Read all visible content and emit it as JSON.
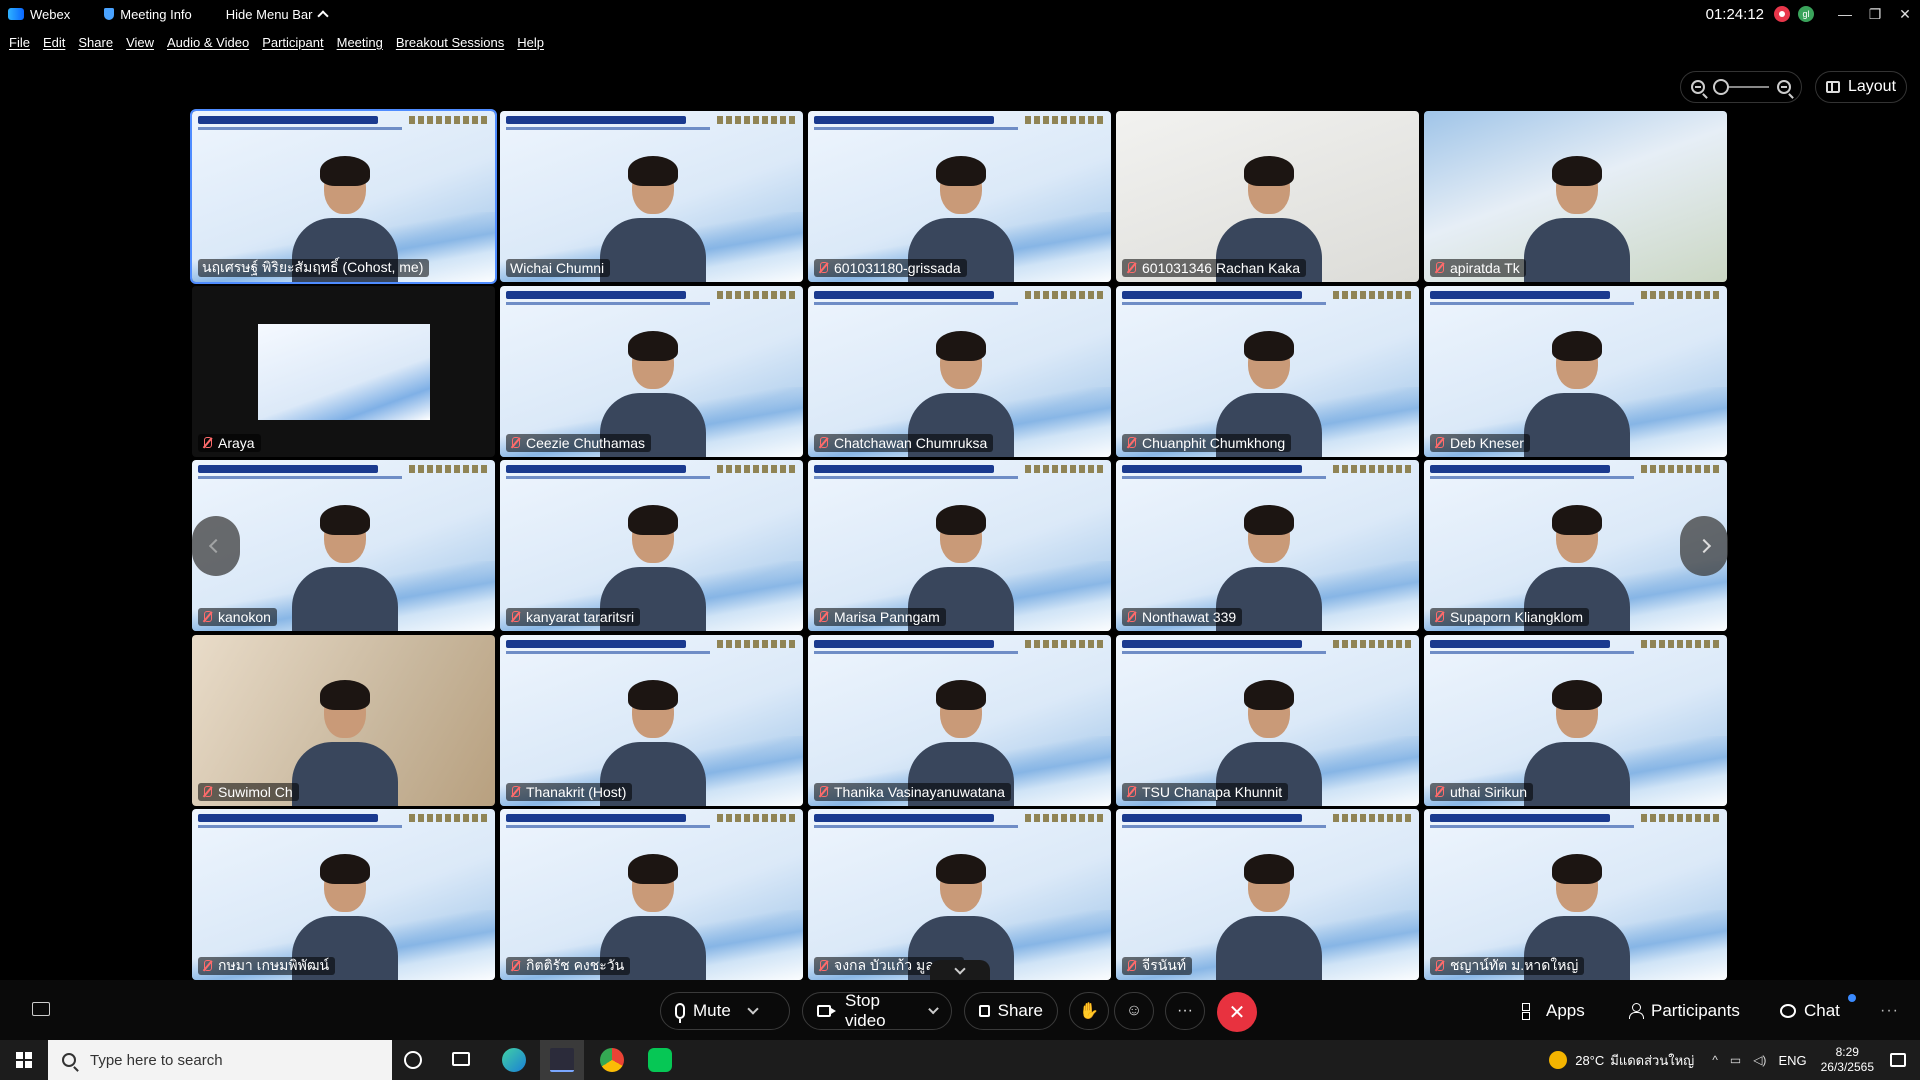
{
  "titlebar": {
    "app_name": "Webex",
    "meeting_info": "Meeting Info",
    "hide_menu": "Hide Menu Bar",
    "clock": "01:24:12",
    "avatar_initial": "gl",
    "window_controls": [
      "—",
      "❐",
      "✕"
    ]
  },
  "menu": [
    "File",
    "Edit",
    "Share",
    "View",
    "Audio & Video",
    "Participant",
    "Meeting",
    "Breakout Sessions",
    "Help"
  ],
  "layout_button": "Layout",
  "tiles": [
    {
      "name": "นฤเศรษฐ์ พิริยะสัมฤทธิ์ (Cohost, me)",
      "muted": false,
      "style": "banner",
      "active": true
    },
    {
      "name": "Wichai Chumni",
      "muted": false,
      "style": "banner"
    },
    {
      "name": "601031180-grissada",
      "muted": true,
      "style": "banner"
    },
    {
      "name": "601031346 Rachan Kaka",
      "muted": true,
      "style": "wall"
    },
    {
      "name": "apiratda Tk",
      "muted": true,
      "style": "photo"
    },
    {
      "name": "Araya",
      "muted": true,
      "style": "dark"
    },
    {
      "name": "Ceezie Chuthamas",
      "muted": true,
      "style": "banner"
    },
    {
      "name": "Chatchawan Chumruksa",
      "muted": true,
      "style": "banner"
    },
    {
      "name": "Chuanphit Chumkhong",
      "muted": true,
      "style": "banner"
    },
    {
      "name": "Deb Kneser",
      "muted": true,
      "style": "banner"
    },
    {
      "name": "kanokon",
      "muted": true,
      "style": "banner"
    },
    {
      "name": "kanyarat tararitsri",
      "muted": true,
      "style": "banner"
    },
    {
      "name": "Marisa Panngam",
      "muted": true,
      "style": "banner"
    },
    {
      "name": "Nonthawat 339",
      "muted": true,
      "style": "banner"
    },
    {
      "name": "Supaporn Kliangklom",
      "muted": true,
      "style": "banner"
    },
    {
      "name": "Suwimol Ch",
      "muted": true,
      "style": "room"
    },
    {
      "name": "Thanakrit (Host)",
      "muted": true,
      "style": "banner"
    },
    {
      "name": "Thanika Vasinayanuwatana",
      "muted": true,
      "style": "banner"
    },
    {
      "name": "TSU Chanapa Khunnit",
      "muted": true,
      "style": "banner"
    },
    {
      "name": "uthai Sirikun",
      "muted": true,
      "style": "banner"
    },
    {
      "name": "กษมา เกษมพิพัฒน์",
      "muted": true,
      "style": "banner"
    },
    {
      "name": "กิตติรัช คงชะวัน",
      "muted": true,
      "style": "banner"
    },
    {
      "name": "จงกล บัวแก้ว มูลสาร",
      "muted": true,
      "style": "banner"
    },
    {
      "name": "จีรนันท์",
      "muted": true,
      "style": "banner"
    },
    {
      "name": "ชญาน์ทัต ม.หาดใหญ่",
      "muted": true,
      "style": "banner"
    }
  ],
  "controls": {
    "mute": "Mute",
    "stop_video": "Stop video",
    "share": "Share",
    "apps": "Apps",
    "participants": "Participants",
    "chat": "Chat",
    "more": "···",
    "end": "✕"
  },
  "taskbar": {
    "search_placeholder": "Type here to search",
    "temperature": "28°C",
    "weather_text": "มีแดดส่วนใหญ่",
    "language": "ENG",
    "time": "8:29",
    "date": "26/3/2565"
  },
  "colors": {
    "accent": "#4f8cff",
    "end_call": "#e8323f",
    "recording": "#e8364a"
  }
}
